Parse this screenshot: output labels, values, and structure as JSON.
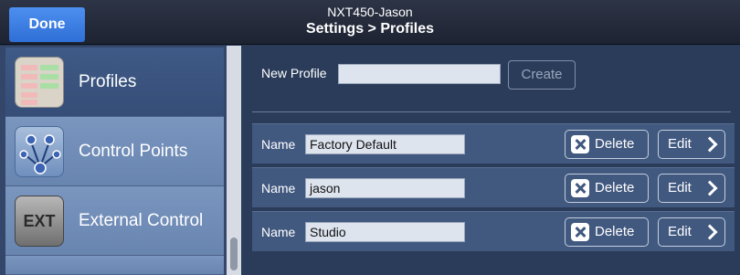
{
  "header": {
    "done_label": "Done",
    "device_name": "NXT450-Jason",
    "page_title": "Settings > Profiles"
  },
  "sidebar": {
    "items": [
      {
        "label": "Profiles",
        "icon": "profiles-icon",
        "active": true
      },
      {
        "label": "Control Points",
        "icon": "control-points-icon",
        "active": false
      },
      {
        "label": "External Control",
        "icon": "ext-icon",
        "icon_text": "EXT",
        "active": false
      }
    ]
  },
  "new_profile": {
    "label": "New Profile",
    "value": "",
    "create_label": "Create"
  },
  "profiles": {
    "name_label": "Name",
    "delete_label": "Delete",
    "edit_label": "Edit",
    "rows": [
      {
        "name": "Factory Default"
      },
      {
        "name": "jason"
      },
      {
        "name": "Studio"
      }
    ]
  },
  "colors": {
    "accent": "#3b7fe6",
    "header_bg": "#262d3d",
    "main_bg": "#2b3c5b",
    "row_bg": "#41587f",
    "sidebar_item_bg": "#7190bb"
  }
}
